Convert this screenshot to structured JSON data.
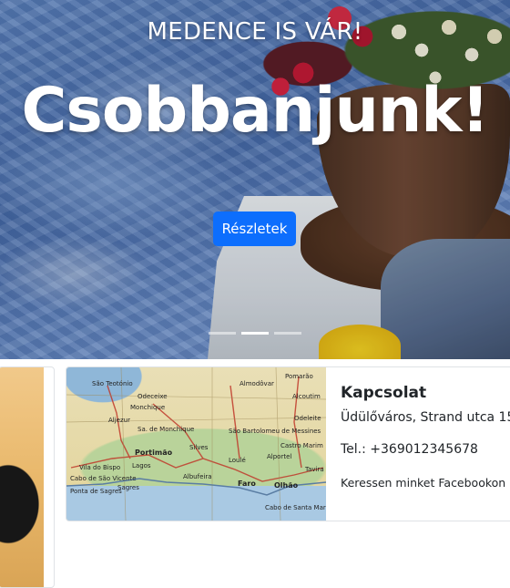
{
  "hero": {
    "subtitle": "MEDENCE IS VÁR!",
    "title": "Csobbanjunk!",
    "button_label": "Részletek",
    "indicators": [
      {
        "active": false
      },
      {
        "active": true
      },
      {
        "active": false
      }
    ]
  },
  "contact": {
    "title": "Kapcsolat",
    "address": "Üdülőváros, Strand utca 15",
    "phone": "Tel.: +369012345678",
    "facebook": "Keressen minket Facebookon",
    "map_labels": [
      "São Teotónio",
      "Odeceixe",
      "Monchique",
      "Aljezur",
      "Portimão",
      "Lagos",
      "Silves",
      "Albufeira",
      "Loulé",
      "Faro",
      "Olhão",
      "Tavira",
      "Almodôvar",
      "Pomarão",
      "Alcoutim",
      "Vila do Bispo",
      "Sagres",
      "Cabo de São Vicente",
      "Ponta de Sagres",
      "Sa. de Monchique",
      "São Bartolomeu de Messines",
      "Odeleite",
      "Castro Marim",
      "Alportel",
      "Cabo de Santa Maria"
    ]
  },
  "colors": {
    "accent": "#0d6efd",
    "text": "#212529",
    "border": "#dfe2e6"
  }
}
